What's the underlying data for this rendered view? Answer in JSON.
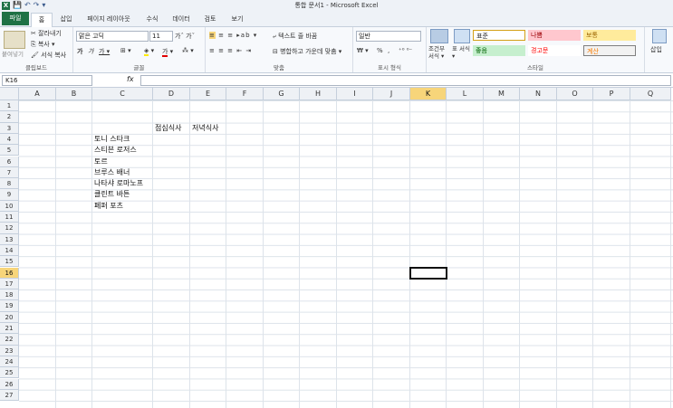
{
  "window": {
    "title": "통합 문서1 - Microsoft Excel"
  },
  "qat": [
    "💾",
    "↶",
    "↷",
    "▾"
  ],
  "tabs": [
    "파일",
    "홈",
    "삽입",
    "페이지 레이아웃",
    "수식",
    "데이터",
    "검토",
    "보기"
  ],
  "ribbon": {
    "clipboard": {
      "paste": "붙여넣기",
      "cut": "잘라내기",
      "copy": "복사 ▾",
      "format_painter": "서식 복사",
      "label": "클립보드"
    },
    "font": {
      "name": "맑은 고딕",
      "size": "11",
      "label": "글꼴",
      "bold": "가",
      "italic": "가",
      "underline": "가 ▾"
    },
    "align": {
      "wrap": "텍스트 줄 바꿈",
      "merge": "병합하고 가운데 맞춤 ▾",
      "label": "맞춤"
    },
    "number": {
      "format": "일반",
      "label": "표시 형식",
      "currency": "₩ ▾",
      "percent": "%",
      "comma": ","
    },
    "styles": {
      "conditional": "조건부 서식 ▾",
      "table": "표 서식 ▾",
      "normal": "표준",
      "bad": "나쁨",
      "neutral": "보통",
      "good": "좋음",
      "warning": "경고문",
      "calc": "계산",
      "label": "스타일"
    },
    "insert": "삽입"
  },
  "formula_bar": {
    "namebox": "K16",
    "fx": "fx",
    "value": ""
  },
  "columns": [
    "A",
    "B",
    "C",
    "D",
    "E",
    "F",
    "G",
    "H",
    "I",
    "J",
    "K",
    "L",
    "M",
    "N",
    "O",
    "P",
    "Q"
  ],
  "rows": [
    "1",
    "2",
    "3",
    "4",
    "5",
    "6",
    "7",
    "8",
    "9",
    "10",
    "11",
    "12",
    "13",
    "14",
    "15",
    "16",
    "17",
    "18",
    "19",
    "20",
    "21",
    "22",
    "23",
    "24",
    "25",
    "26",
    "27"
  ],
  "cells": {
    "D3": "점심식사",
    "E3": "저녁식사",
    "C4": "토니 스타크",
    "C5": "스티븐 로저스",
    "C6": "토르",
    "C7": "브루스 배너",
    "C8": "나타샤 로마노프",
    "C9": "클린트 바튼",
    "C10": "페퍼 포츠"
  },
  "selected_cell": "K16"
}
